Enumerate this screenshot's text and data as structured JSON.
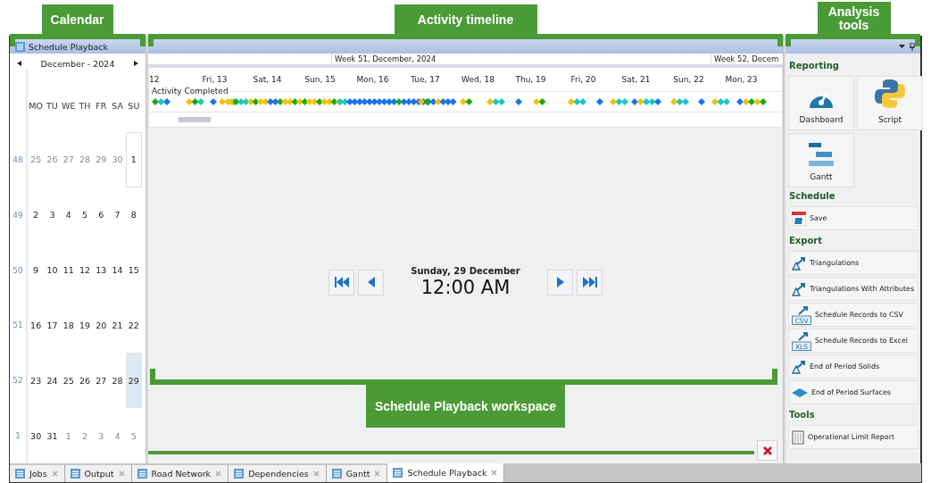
{
  "annotations": {
    "calendar": "Calendar",
    "timeline": "Activity timeline",
    "analysis": "Analysis tools",
    "workspace": "Schedule Playback workspace"
  },
  "calendar": {
    "title": "Schedule Playback",
    "month": "December - 2024",
    "weekdays": [
      "MO",
      "TU",
      "WE",
      "TH",
      "FR",
      "SA",
      "SU"
    ],
    "weeks": [
      {
        "number": "48",
        "days": [
          {
            "text": "25",
            "other_month": true,
            "selected": false,
            "today": false
          },
          {
            "text": "26",
            "other_month": true,
            "selected": false,
            "today": false
          },
          {
            "text": "27",
            "other_month": true,
            "selected": false,
            "today": false
          },
          {
            "text": "28",
            "other_month": true,
            "selected": false,
            "today": false
          },
          {
            "text": "29",
            "other_month": true,
            "selected": false,
            "today": false
          },
          {
            "text": "30",
            "other_month": true,
            "selected": false,
            "today": false
          },
          {
            "text": "1",
            "other_month": false,
            "selected": false,
            "today": true
          }
        ]
      },
      {
        "number": "49",
        "days": [
          {
            "text": "2",
            "other_month": false,
            "selected": false,
            "today": false
          },
          {
            "text": "3",
            "other_month": false,
            "selected": false,
            "today": false
          },
          {
            "text": "4",
            "other_month": false,
            "selected": false,
            "today": false
          },
          {
            "text": "5",
            "other_month": false,
            "selected": false,
            "today": false
          },
          {
            "text": "6",
            "other_month": false,
            "selected": false,
            "today": false
          },
          {
            "text": "7",
            "other_month": false,
            "selected": false,
            "today": false
          },
          {
            "text": "8",
            "other_month": false,
            "selected": false,
            "today": false
          }
        ]
      },
      {
        "number": "50",
        "days": [
          {
            "text": "9",
            "other_month": false,
            "selected": false,
            "today": false
          },
          {
            "text": "10",
            "other_month": false,
            "selected": false,
            "today": false
          },
          {
            "text": "11",
            "other_month": false,
            "selected": false,
            "today": false
          },
          {
            "text": "12",
            "other_month": false,
            "selected": false,
            "today": false
          },
          {
            "text": "13",
            "other_month": false,
            "selected": false,
            "today": false
          },
          {
            "text": "14",
            "other_month": false,
            "selected": false,
            "today": false
          },
          {
            "text": "15",
            "other_month": false,
            "selected": false,
            "today": false
          }
        ]
      },
      {
        "number": "51",
        "days": [
          {
            "text": "16",
            "other_month": false,
            "selected": false,
            "today": false
          },
          {
            "text": "17",
            "other_month": false,
            "selected": false,
            "today": false
          },
          {
            "text": "18",
            "other_month": false,
            "selected": false,
            "today": false
          },
          {
            "text": "19",
            "other_month": false,
            "selected": false,
            "today": false
          },
          {
            "text": "20",
            "other_month": false,
            "selected": false,
            "today": false
          },
          {
            "text": "21",
            "other_month": false,
            "selected": false,
            "today": false
          },
          {
            "text": "22",
            "other_month": false,
            "selected": false,
            "today": false
          }
        ]
      },
      {
        "number": "52",
        "days": [
          {
            "text": "23",
            "other_month": false,
            "selected": false,
            "today": false
          },
          {
            "text": "24",
            "other_month": false,
            "selected": false,
            "today": false
          },
          {
            "text": "25",
            "other_month": false,
            "selected": false,
            "today": false
          },
          {
            "text": "26",
            "other_month": false,
            "selected": false,
            "today": false
          },
          {
            "text": "27",
            "other_month": false,
            "selected": false,
            "today": false
          },
          {
            "text": "28",
            "other_month": false,
            "selected": false,
            "today": false
          },
          {
            "text": "29",
            "other_month": false,
            "selected": true,
            "today": false
          }
        ]
      },
      {
        "number": "1",
        "days": [
          {
            "text": "30",
            "other_month": false,
            "selected": false,
            "today": false
          },
          {
            "text": "31",
            "other_month": false,
            "selected": false,
            "today": false
          },
          {
            "text": "1",
            "other_month": true,
            "selected": false,
            "today": false
          },
          {
            "text": "2",
            "other_month": true,
            "selected": false,
            "today": false
          },
          {
            "text": "3",
            "other_month": true,
            "selected": false,
            "today": false
          },
          {
            "text": "4",
            "other_month": true,
            "selected": false,
            "today": false
          },
          {
            "text": "5",
            "other_month": true,
            "selected": false,
            "today": false
          }
        ]
      }
    ]
  },
  "timeline": {
    "weeks": [
      "Week 51, December, 2024",
      "Week 52, Decem"
    ],
    "days": [
      "12",
      "Fri, 13",
      "Sat, 14",
      "Sun, 15",
      "Mon, 16",
      "Tue, 17",
      "Wed, 18",
      "Thu, 19",
      "Fri, 20",
      "Sat, 21",
      "Sun, 22",
      "Mon, 23"
    ],
    "row_label": "Activity Completed"
  },
  "playback": {
    "date": "Sunday, 29 December",
    "time": "12:00 AM"
  },
  "analysis": {
    "sections": [
      {
        "title": "Reporting",
        "kind": "tiles",
        "items": [
          {
            "label": "Dashboard",
            "kind": "dashboard"
          },
          {
            "label": "Script",
            "kind": "script"
          },
          {
            "label": "Gantt",
            "kind": "gantt"
          }
        ]
      },
      {
        "title": "Schedule",
        "kind": "list",
        "items": [
          {
            "label": "Save",
            "kind": "save"
          }
        ]
      },
      {
        "title": "Export",
        "kind": "list",
        "items": [
          {
            "label": "Triangulations",
            "kind": "triangulation"
          },
          {
            "label": "Triangulations With Attributes",
            "kind": "triangulation"
          },
          {
            "label": "Schedule Records to CSV",
            "kind": "file",
            "icon_text": "CSV"
          },
          {
            "label": "Schedule Records to Excel",
            "kind": "file",
            "icon_text": "XLS"
          },
          {
            "label": "End of Period Solids",
            "kind": "triangulation"
          },
          {
            "label": "End of Period Surfaces",
            "kind": "surface"
          }
        ]
      },
      {
        "title": "Tools",
        "kind": "list",
        "items": [
          {
            "label": "Operational Limit Report",
            "kind": "report"
          }
        ]
      }
    ]
  },
  "tabs": [
    {
      "label": "Jobs",
      "selected": false
    },
    {
      "label": "Output",
      "selected": false
    },
    {
      "label": "Road Network",
      "selected": false
    },
    {
      "label": "Dependencies",
      "selected": false
    },
    {
      "label": "Gantt",
      "selected": false
    },
    {
      "label": "Schedule Playback",
      "selected": true
    }
  ]
}
